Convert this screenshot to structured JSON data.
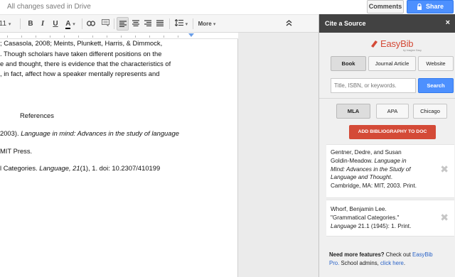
{
  "topbar": {
    "saved_status": "All changes saved in Drive",
    "comments_label": "Comments",
    "share_label": "Share"
  },
  "toolbar": {
    "font_size": "11",
    "bold": "B",
    "italic": "I",
    "underline": "U",
    "text_color": "A",
    "more_label": "More",
    "collapse_icon": "double-chevron-up-icon"
  },
  "document": {
    "lines": [
      "; Casasola, 2008; Meints, Plunkett, Harris, & Dimmock,",
      ". Though scholars have taken different positions on the",
      "e and thought, there is evidence that the characteristics of",
      ", in fact, affect how a speaker mentally represents and"
    ],
    "references_heading": "References",
    "ref1_plain": "2003). ",
    "ref1_italic": "Language in mind: Advances in the study of language",
    "ref1_cont": "MIT Press.",
    "ref2_plain": "l Categories. ",
    "ref2_italic": "Language, 21",
    "ref2_end": "(1), 1. doi: 10.2307/410199"
  },
  "panel": {
    "title": "Cite a Source",
    "close": "×",
    "logo_text": "EasyBib",
    "logo_sub": "by Imagine Easy",
    "source_tabs": [
      "Book",
      "Journal Article",
      "Website"
    ],
    "search_placeholder": "Title, ISBN, or keywords.",
    "search_button": "Search",
    "style_tabs": [
      "MLA",
      "APA",
      "Chicago"
    ],
    "selected_style": "MLA",
    "add_button": "ADD BIBLIOGRAPHY TO DOC",
    "citation1": {
      "line1": "Gentner, Dedre, and Susan",
      "line2": "Goldin-Meadow. ",
      "line2_italic": "Language in",
      "line3_italic": "Mind: Advances in the Study of",
      "line4_italic": "Language and Thought",
      "line4_end": ".",
      "line5": "Cambridge, MA: MIT, 2003. Print."
    },
    "citation2": {
      "line1": "Whorf, Benjamin Lee.",
      "line2": "\"Grammatical Categories.\"",
      "line3_italic": "Language",
      "line3_end": " 21.1 (1945): 1. Print."
    },
    "footer": {
      "bold": "Need more features?",
      "text1": " Check out ",
      "link1": "EasyBib",
      "link1b": "Pro.",
      "text2": " School admins, ",
      "link2": "click here",
      "text3": "."
    }
  },
  "colors": {
    "accent_blue": "#4d90fe",
    "easybib_red": "#d44a37",
    "panel_header": "#424242"
  }
}
